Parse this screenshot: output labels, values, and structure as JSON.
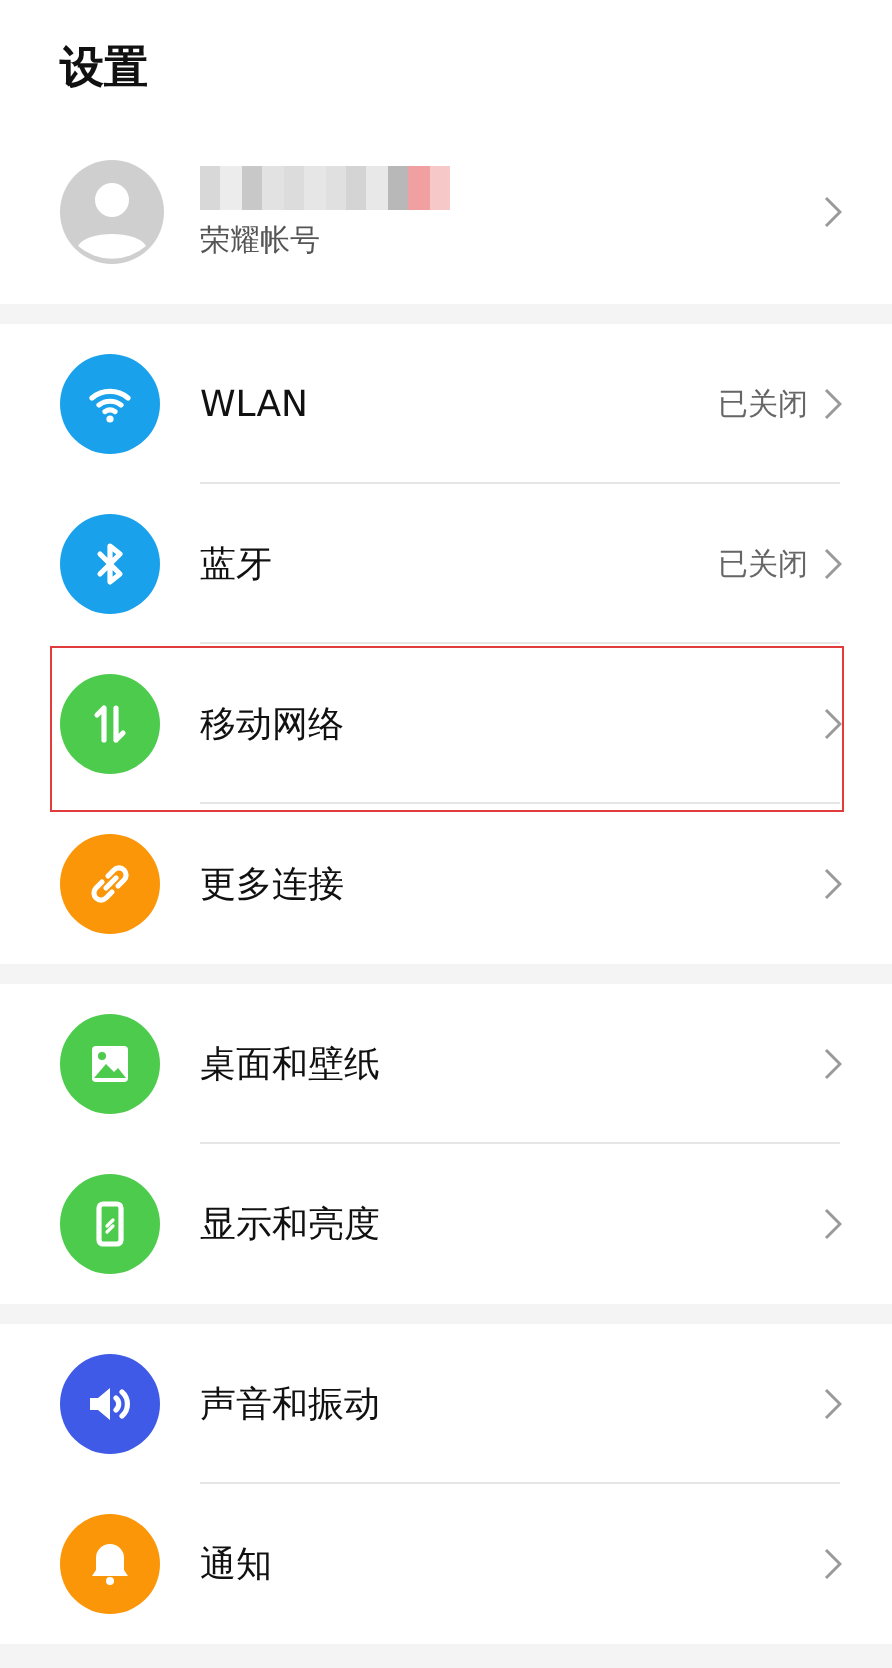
{
  "title": "设置",
  "account": {
    "label": "荣耀帐号"
  },
  "groups": [
    {
      "items": [
        {
          "kind": "wifi",
          "color": "#1aa1eb",
          "label": "WLAN",
          "value": "已关闭",
          "highlighted": false
        },
        {
          "kind": "bluetooth",
          "color": "#1aa1eb",
          "label": "蓝牙",
          "value": "已关闭",
          "highlighted": false
        },
        {
          "kind": "mobile-data",
          "color": "#4ccb4c",
          "label": "移动网络",
          "highlighted": true
        },
        {
          "kind": "link",
          "color": "#fb9608",
          "label": "更多连接",
          "highlighted": false
        }
      ]
    },
    {
      "items": [
        {
          "kind": "image",
          "color": "#4ccb4c",
          "label": "桌面和壁纸",
          "highlighted": false
        },
        {
          "kind": "phone",
          "color": "#4ccb4c",
          "label": "显示和亮度",
          "highlighted": false
        }
      ]
    },
    {
      "items": [
        {
          "kind": "speaker",
          "color": "#3f5ae6",
          "label": "声音和振动",
          "highlighted": false
        },
        {
          "kind": "bell",
          "color": "#fb9608",
          "label": "通知",
          "highlighted": false
        }
      ]
    }
  ]
}
